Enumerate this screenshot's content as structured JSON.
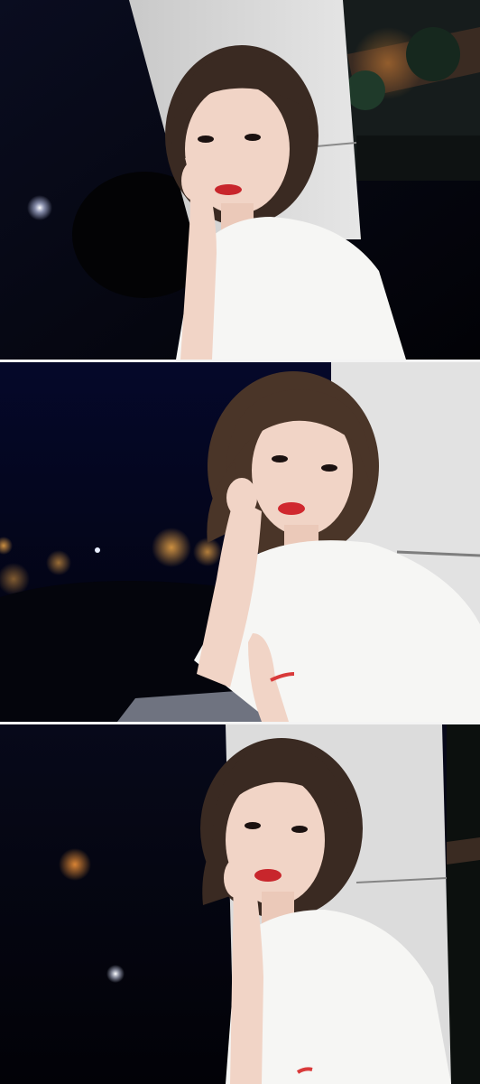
{
  "image": {
    "description_panels": 3
  },
  "palette": {
    "night": "#070a1c",
    "wall": "#dcdcdc",
    "shirt": "#f6f6f4",
    "skin": "#f1d4c6",
    "hair": "#3a2a22",
    "lips": "#c8262c",
    "light": "#ffb24a",
    "bracelet": "#d93a3a"
  }
}
